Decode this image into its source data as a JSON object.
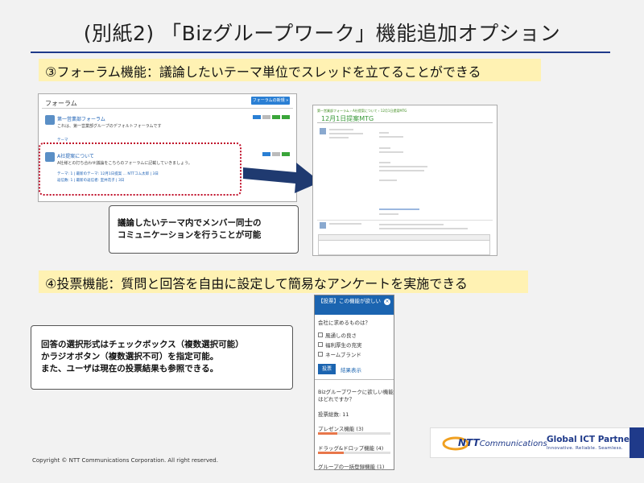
{
  "slide": {
    "title": "(別紙2) 「Bizグループワーク」機能追加オプション",
    "section1_heading": "③フォーラム機能：議論したいテーマ単位でスレッドを立てることができる",
    "section2_heading": "④投票機能：質問と回答を自由に設定して簡易なアンケートを実施できる",
    "callout1": [
      "議論したいテーマ内でメンバー同士の",
      "コミュニケーションを行うことが可能"
    ],
    "callout2": [
      "回答の選択形式はチェックボックス（複数選択可能）",
      "かラジオボタン（複数選択不可）を指定可能。",
      "また、ユーザは現在の投票結果も参照できる。"
    ],
    "copyright": "Copyright © NTT Communications Corporation. All right reserved."
  },
  "forum": {
    "title": "フォーラム",
    "new_button": "フォーラムの新規 »",
    "items": [
      {
        "title": "第一営業部フォーラム",
        "desc": "これは、第一営業部グループのデフォルトフォーラムです"
      },
      {
        "title": "A社提案について",
        "desc": "A社様との打ち合わせ議論をこちらのフォーラムに記載していきましょう。"
      }
    ],
    "meta_label": "テーマ",
    "meta_line1": "テーマ: 1 | 最新のテーマ: 12月1日提案 ... NTTコム太郎 | 3日",
    "meta_line2": "返信数: 1 | 最新の返信者: 室井花子 | 3日"
  },
  "thread": {
    "breadcrumb": "第一営業部フォーラム › A社提案について › 12月1日提案MTG",
    "heading": "12月1日提案MTG"
  },
  "poll": {
    "header": "【投票】この機能が欲しい",
    "question": "会社に求めるものは？",
    "options": [
      "風通しの良さ",
      "福利厚生の充実",
      "ネームブランド"
    ],
    "vote_button": "投票",
    "results_link": "結果表示",
    "question2": "Bizグループワークに欲しい機能はどれですか？",
    "total": "投票総数: 11",
    "results": [
      {
        "label": "プレゼンス機能 (3)",
        "share": 0.27
      },
      {
        "label": "ドラッグ&ドロップ機能 (4)",
        "share": 0.36
      },
      {
        "label": "グループの一括登録機能 (1)",
        "share": 0.09
      }
    ]
  },
  "logo": {
    "brand": "NTT",
    "brand_suffix": "Communications",
    "partner": "Global ICT Partner",
    "tagline": "Innovative. Reliable. Seamless."
  },
  "colors": {
    "accent_blue": "#1f3a8a",
    "heading_bg": "#fff2b3",
    "dotted_red": "#c0102a"
  }
}
